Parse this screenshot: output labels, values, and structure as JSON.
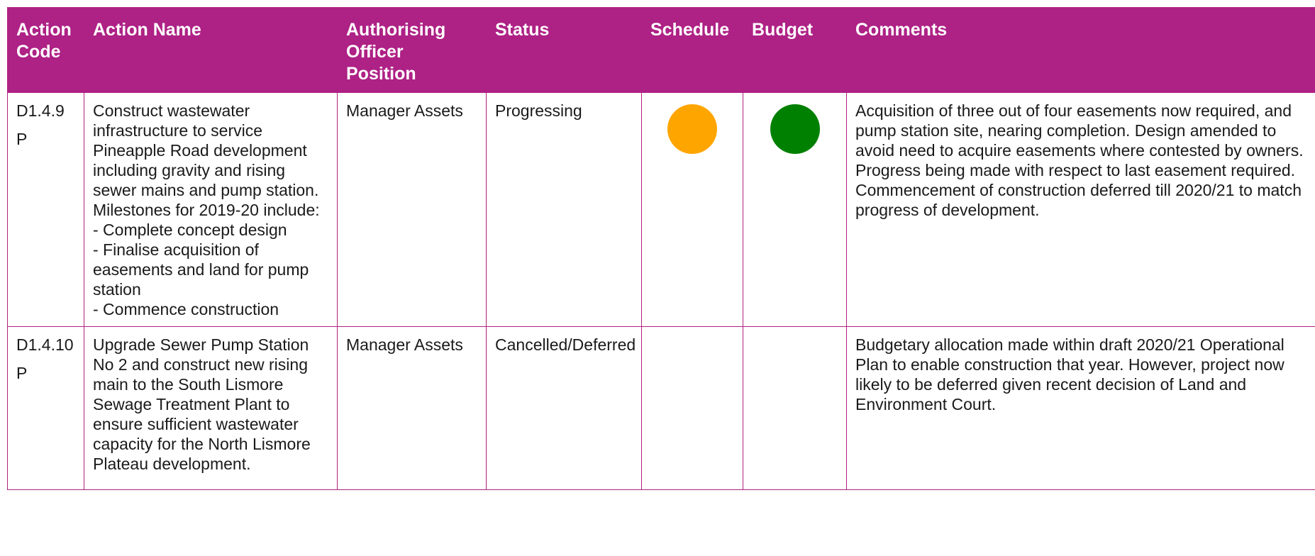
{
  "headers": {
    "action_code": "Action\nCode",
    "action_name": "Action Name",
    "officer": "Authorising\nOfficer\nPosition",
    "status": "Status",
    "schedule": "Schedule",
    "budget": "Budget",
    "comments": "Comments"
  },
  "rows": [
    {
      "code": "D1.4.9",
      "code_suffix": "P",
      "action_name": "Construct wastewater infrastructure to service Pineapple Road development including gravity and rising sewer mains and pump station.\nMilestones for 2019-20 include:\n- Complete concept design\n- Finalise acquisition of easements and land for pump station\n- Commence construction",
      "officer": "Manager Assets",
      "status": "Progressing",
      "schedule_color": "#ffa500",
      "budget_color": "#008000",
      "comments": "Acquisition of three out of four easements now required, and pump station site, nearing completion. Design amended to avoid need to acquire easements where contested by owners. Progress being made with respect to last easement required. Commencement of construction deferred till 2020/21 to match progress of development."
    },
    {
      "code": "D1.4.10",
      "code_suffix": "P",
      "action_name": "Upgrade Sewer Pump Station No 2 and construct new rising main to the South Lismore Sewage Treatment Plant to ensure sufficient wastewater capacity for the North Lismore Plateau development.",
      "officer": "Manager Assets",
      "status": "Cancelled/Deferred",
      "schedule_color": "",
      "budget_color": "",
      "comments": "Budgetary allocation made within draft 2020/21 Operational Plan to enable construction that year. However, project now likely to be deferred given recent decision of Land and Environment Court."
    }
  ],
  "colors": {
    "header_bg": "#ae2185",
    "border": "#b0227f",
    "amber": "#ffa500",
    "green": "#008000"
  }
}
